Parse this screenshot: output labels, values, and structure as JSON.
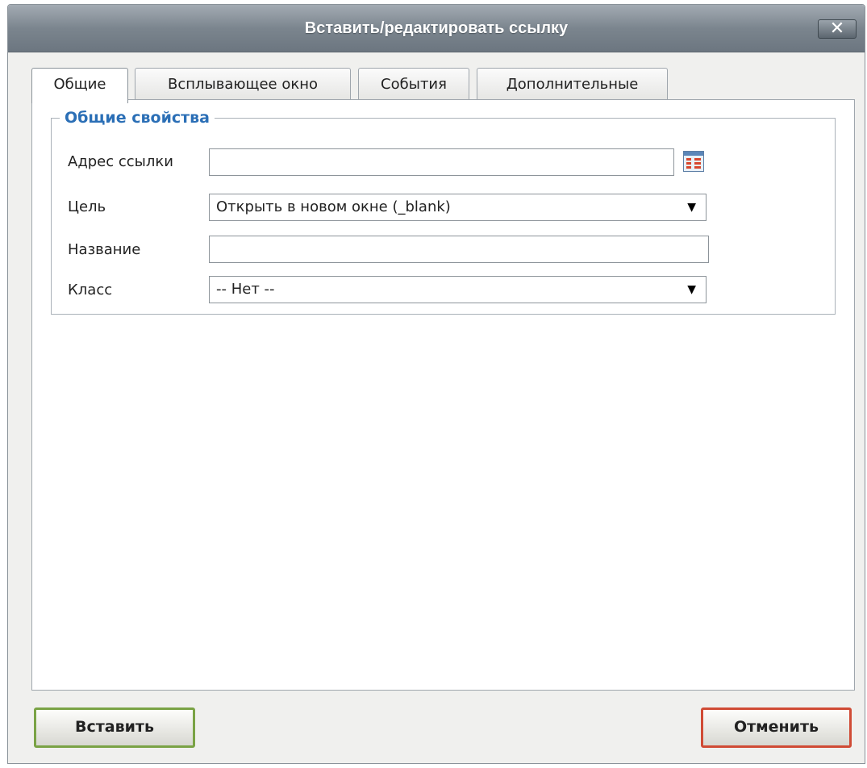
{
  "dialog": {
    "title": "Вставить/редактировать ссылку",
    "close_label": "✕"
  },
  "tabs": [
    {
      "label": "Общие",
      "active": true
    },
    {
      "label": "Всплывающее окно",
      "active": false
    },
    {
      "label": "События",
      "active": false
    },
    {
      "label": "Дополнительные",
      "active": false
    }
  ],
  "general": {
    "legend": "Общие свойства",
    "url_label": "Адрес ссылки",
    "url_value": "",
    "browse_icon": "browse-icon",
    "target_label": "Цель",
    "target_value": "Открыть в новом окне (_blank)",
    "title_label": "Название",
    "title_value": "",
    "class_label": "Класс",
    "class_value": "-- Нет --",
    "dropdown_arrow": "▼"
  },
  "buttons": {
    "insert": "Вставить",
    "cancel": "Отменить"
  },
  "colors": {
    "accent": "#2b6fb6",
    "insert_border": "#7aa345",
    "cancel_border": "#d04b35"
  }
}
